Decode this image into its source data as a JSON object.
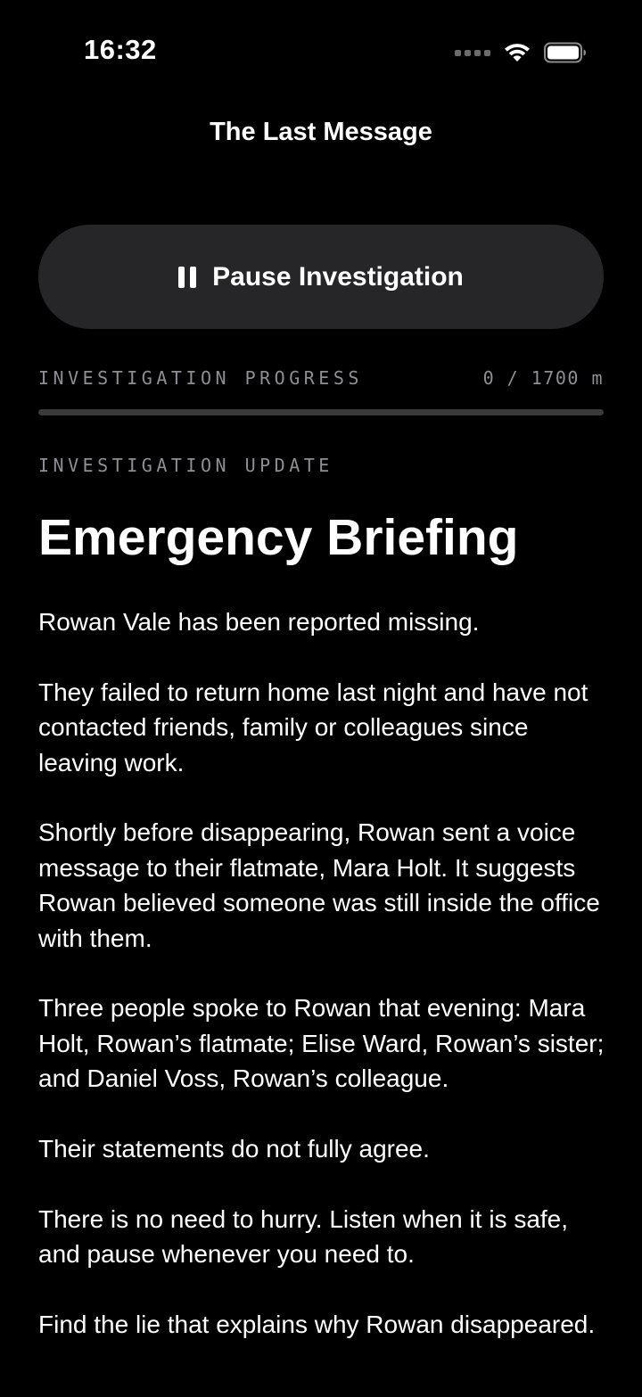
{
  "status_bar": {
    "time": "16:32",
    "icons": [
      "cellular-dots-icon",
      "wifi-icon",
      "battery-icon"
    ]
  },
  "nav": {
    "title": "The Last Message"
  },
  "pause_button": {
    "label": "Pause Investigation",
    "icon": "pause-icon"
  },
  "progress": {
    "label": "INVESTIGATION PROGRESS",
    "value_text": "0 / 1700 m",
    "current": 0,
    "total": 1700,
    "fraction": 0
  },
  "section_label": "INVESTIGATION UPDATE",
  "briefing": {
    "title": "Emergency Briefing",
    "paragraphs": [
      "Rowan Vale has been reported missing.",
      "They failed to return home last night and have not contacted friends, family or colleagues since leaving work.",
      "Shortly before disappearing, Rowan sent a voice message to their flatmate, Mara Holt. It suggests Rowan believed someone was still inside the office with them.",
      "Three people spoke to Rowan that evening: Mara Holt, Rowan’s flatmate; Elise Ward, Rowan’s sister; and Daniel Voss, Rowan’s colleague.",
      "Their statements do not fully agree.",
      "There is no need to hurry. Listen when it is safe, and pause whenever you need to.",
      "Find the lie that explains why Rowan disappeared."
    ]
  },
  "colors": {
    "background": "#000000",
    "button_bg": "#262628",
    "muted_text": "#8e8e93",
    "track": "#3a3a3c"
  }
}
